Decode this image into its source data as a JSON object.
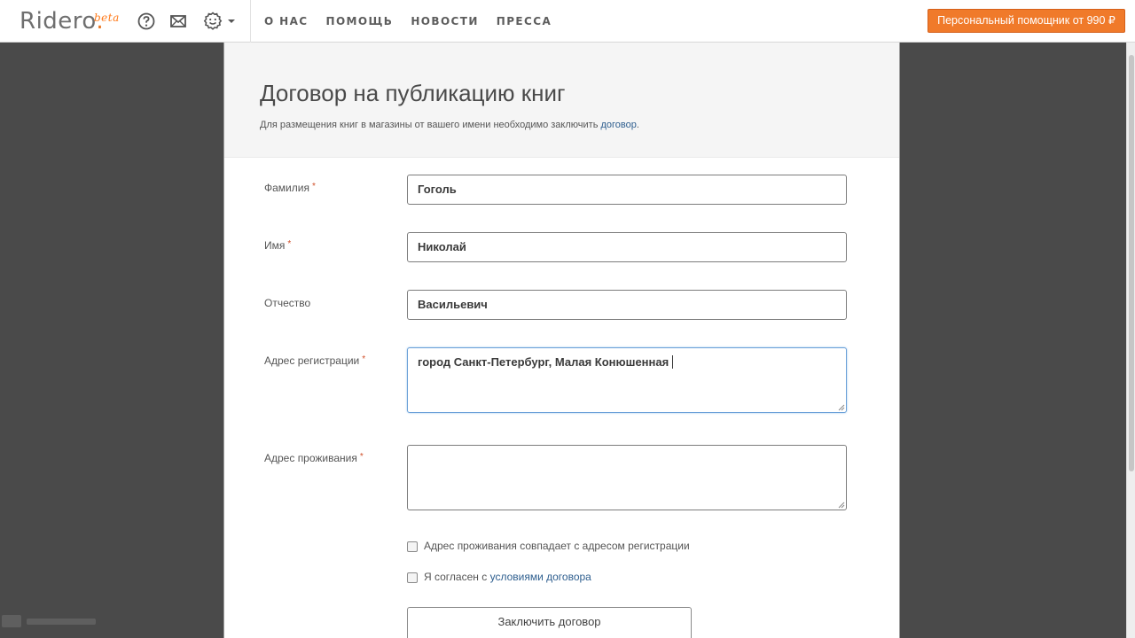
{
  "header": {
    "logo": "Ridero",
    "logo_dot": ".",
    "logo_beta": "beta",
    "icons": [
      "help-icon",
      "mail-icon",
      "smiley-icon",
      "chevron-down-icon"
    ],
    "nav": [
      "О НАС",
      "ПОМОЩЬ",
      "НОВОСТИ",
      "ПРЕССА"
    ],
    "promo_button": "Персональный помощник от 990 ₽"
  },
  "page": {
    "title": "Договор на публикацию книг",
    "subtitle_text": "Для размещения книг в магазины от вашего имени необходимо заключить ",
    "subtitle_link": "договор",
    "subtitle_end": "."
  },
  "form": {
    "required_mark": "*",
    "surname": {
      "label": "Фамилия",
      "value": "Гоголь"
    },
    "name": {
      "label": "Имя",
      "value": "Николай"
    },
    "patronymic": {
      "label": "Отчество",
      "value": "Васильевич"
    },
    "reg_address": {
      "label": "Адрес регистрации",
      "value": "город Санкт-Петербург, Малая Конюшенная "
    },
    "live_address": {
      "label": "Адрес проживания",
      "value": ""
    },
    "same_address_checkbox": "Адрес проживания совпадает с адресом регистрации",
    "agree_text": "Я согласен с ",
    "agree_link": "условиями договора",
    "submit": "Заключить договор"
  },
  "colors": {
    "accent": "#f07a2a",
    "link": "#2f5f8f",
    "background": "#4a4a4a"
  }
}
